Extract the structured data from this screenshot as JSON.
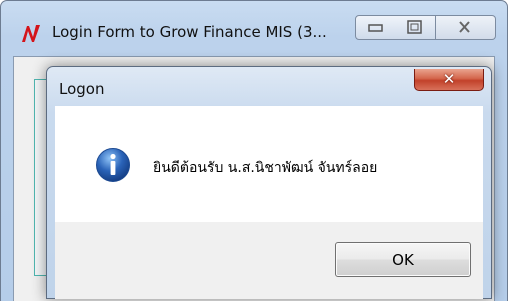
{
  "background_window": {
    "title": "Login Form to Grow Finance MIS (3...",
    "app_icon": "n-logo-icon",
    "buttons": {
      "minimize_icon": "minimize-icon",
      "maximize_icon": "maximize-icon",
      "close_icon": "close-icon"
    }
  },
  "dialog": {
    "title": "Logon",
    "close_icon": "close-icon",
    "message_icon": "info-icon",
    "message": "ยินดีต้อนรับ น.ส.นิชาพัฒน์ จันทร์ลอย",
    "ok_label": "OK"
  },
  "colors": {
    "close_button_red": "#c2412a",
    "info_icon_blue": "#2a63b8",
    "app_icon_red": "#d4141a",
    "panel_teal": "#4fb6b0"
  }
}
